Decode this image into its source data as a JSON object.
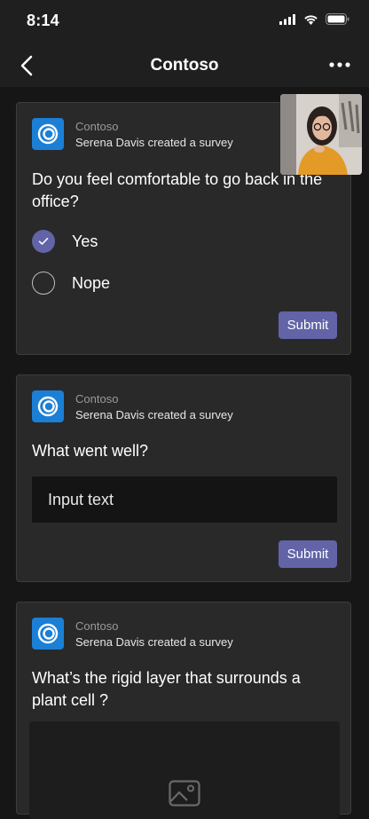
{
  "status": {
    "time": "8:14",
    "icons": [
      "signal-icon",
      "wifi-icon",
      "battery-icon"
    ]
  },
  "nav": {
    "title": "Contoso",
    "back_icon": "chevron-left-icon",
    "more_icon": "more-horizontal-icon"
  },
  "cards": [
    {
      "app_name": "Contoso",
      "subtitle": "Serena Davis created a survey",
      "question": "Do you feel comfortable to go back in the office?",
      "options": [
        {
          "label": "Yes",
          "selected": true
        },
        {
          "label": "Nope",
          "selected": false
        }
      ],
      "submit_label": "Submit"
    },
    {
      "app_name": "Contoso",
      "subtitle": "Serena Davis created a survey",
      "question": "What went well?",
      "input_placeholder": "Input text",
      "submit_label": "Submit"
    },
    {
      "app_name": "Contoso",
      "subtitle": "Serena Davis created a survey",
      "question": "What’s the rigid layer that surrounds a plant cell ?",
      "image_icon": "image-icon"
    }
  ],
  "colors": {
    "accent": "#6264a7",
    "app_icon": "#1b7fd6",
    "background": "#161616",
    "card": "#292929"
  }
}
